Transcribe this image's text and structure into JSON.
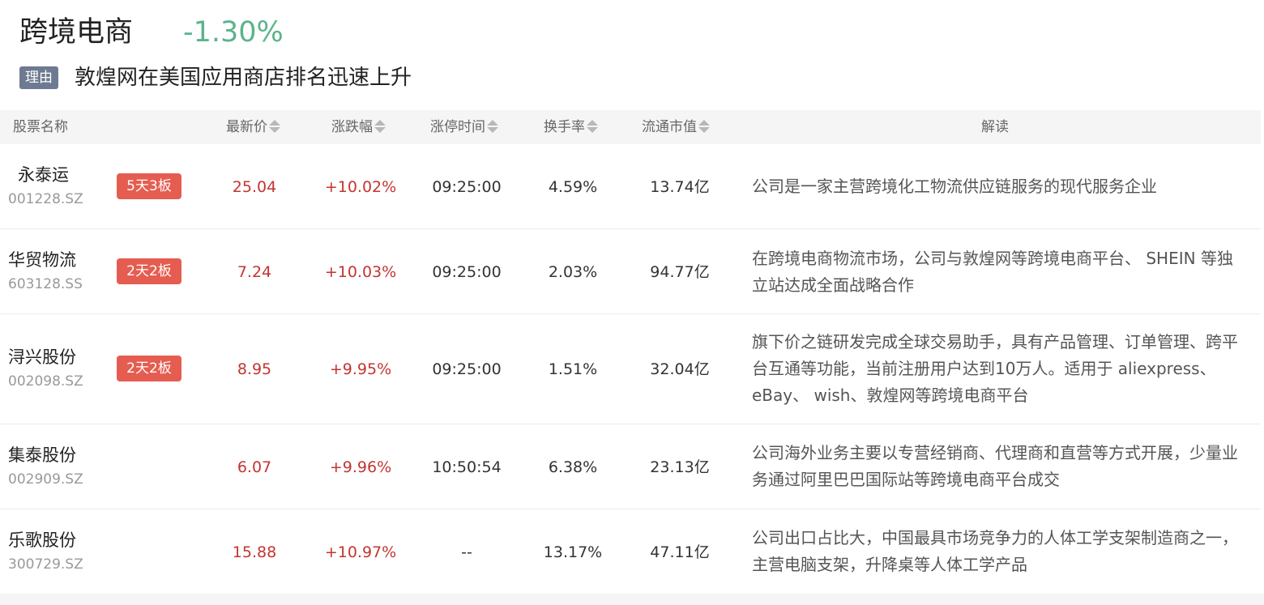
{
  "header": {
    "title": "跨境电商",
    "change": "-1.30%",
    "change_color": "#5cb38a",
    "reason_tag": "理由",
    "reason_text": "敦煌网在美国应用商店排名迅速上升"
  },
  "columns": {
    "name": "股票名称",
    "price": "最新价",
    "pct": "涨跌幅",
    "time": "涨停时间",
    "turnover": "换手率",
    "cap": "流通市值",
    "desc": "解读"
  },
  "colors": {
    "up": "#c23531",
    "badge": "#e55d50",
    "tag": "#6e7a91"
  },
  "rows": [
    {
      "name": "永泰运",
      "code": "001228.SZ",
      "badge": "5天3板",
      "price": "25.04",
      "pct": "+10.02%",
      "time": "09:25:00",
      "turnover": "4.59%",
      "cap": "13.74亿",
      "desc": "公司是一家主营跨境化工物流供应链服务的现代服务企业"
    },
    {
      "name": "华贸物流",
      "code": "603128.SS",
      "badge": "2天2板",
      "price": "7.24",
      "pct": "+10.03%",
      "time": "09:25:00",
      "turnover": "2.03%",
      "cap": "94.77亿",
      "desc": "在跨境电商物流市场，公司与敦煌网等跨境电商平台、 SHEIN 等独立站达成全面战略合作"
    },
    {
      "name": "浔兴股份",
      "code": "002098.SZ",
      "badge": "2天2板",
      "price": "8.95",
      "pct": "+9.95%",
      "time": "09:25:00",
      "turnover": "1.51%",
      "cap": "32.04亿",
      "desc": "旗下价之链研发完成全球交易助手，具有产品管理、订单管理、跨平台互通等功能，当前注册用户达到10万人。适用于 aliexpress、 eBay、 wish、敦煌网等跨境电商平台"
    },
    {
      "name": "集泰股份",
      "code": "002909.SZ",
      "badge": "",
      "price": "6.07",
      "pct": "+9.96%",
      "time": "10:50:54",
      "turnover": "6.38%",
      "cap": "23.13亿",
      "desc": "公司海外业务主要以专营经销商、代理商和直营等方式开展，少量业务通过阿里巴巴国际站等跨境电商平台成交"
    },
    {
      "name": "乐歌股份",
      "code": "300729.SZ",
      "badge": "",
      "price": "15.88",
      "pct": "+10.97%",
      "time": "--",
      "turnover": "13.17%",
      "cap": "47.11亿",
      "desc": "公司出口占比大，中国最具市场竞争力的人体工学支架制造商之一，主营电脑支架，升降桌等人体工学产品"
    }
  ]
}
